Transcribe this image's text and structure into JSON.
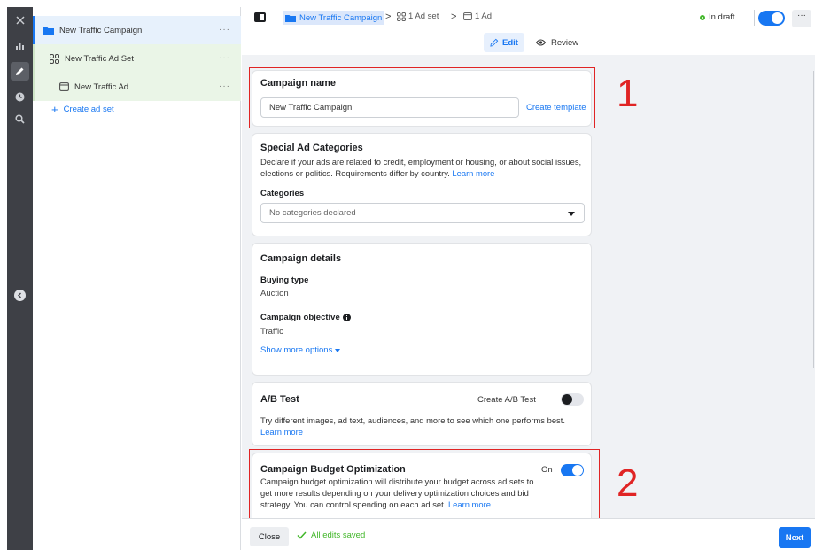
{
  "rail": {
    "icons": [
      "close-icon",
      "chart-icon",
      "pencil-icon",
      "clock-icon",
      "search-icon",
      "collapse-chevron-icon"
    ]
  },
  "tree": {
    "campaign_label": "New Traffic Campaign",
    "adset_label": "New Traffic Ad Set",
    "ad_label": "New Traffic Ad",
    "more_label": "···",
    "create_adset_label": "Create ad set"
  },
  "topbar": {
    "breadcrumb_campaign": "New Traffic Campaign",
    "breadcrumb_adset": "1 Ad set",
    "breadcrumb_ad": "1 Ad",
    "separator": ">",
    "status": "In draft",
    "status_color": "#42b72a",
    "more_label": "···",
    "edit_label": "Edit",
    "review_label": "Review"
  },
  "campaign_name_card": {
    "title": "Campaign name",
    "value": "New Traffic Campaign",
    "create_template": "Create template"
  },
  "special_ad_card": {
    "title": "Special Ad Categories",
    "description": "Declare if your ads are related to credit, employment or housing, or about social issues, elections or politics. Requirements differ by country.",
    "learn_more": "Learn more",
    "categories_label": "Categories",
    "categories_placeholder": "No categories declared"
  },
  "details_card": {
    "title": "Campaign details",
    "buying_type_label": "Buying type",
    "buying_type_value": "Auction",
    "objective_label": "Campaign objective",
    "objective_value": "Traffic",
    "show_more": "Show more options"
  },
  "ab_card": {
    "title": "A/B Test",
    "toggle_label": "Create A/B Test",
    "toggle_on": false,
    "description": "Try different images, ad text, audiences, and more to see which one performs best.",
    "learn_more": "Learn more"
  },
  "cbo_card": {
    "title": "Campaign Budget Optimization",
    "toggle_label": "On",
    "toggle_on": true,
    "description": "Campaign budget optimization will distribute your budget across ad sets to get more results depending on your delivery optimization choices and bid strategy. You can control spending on each ad set.",
    "learn_more": "Learn more"
  },
  "annotations": {
    "one": "1",
    "two": "2",
    "color": "#e02424"
  },
  "bottombar": {
    "close_label": "Close",
    "saved_label": "All edits saved",
    "next_label": "Next"
  },
  "colors": {
    "accent": "#1877f2",
    "rail_bg": "#3e4046",
    "page_bg": "#f0f2f5"
  }
}
